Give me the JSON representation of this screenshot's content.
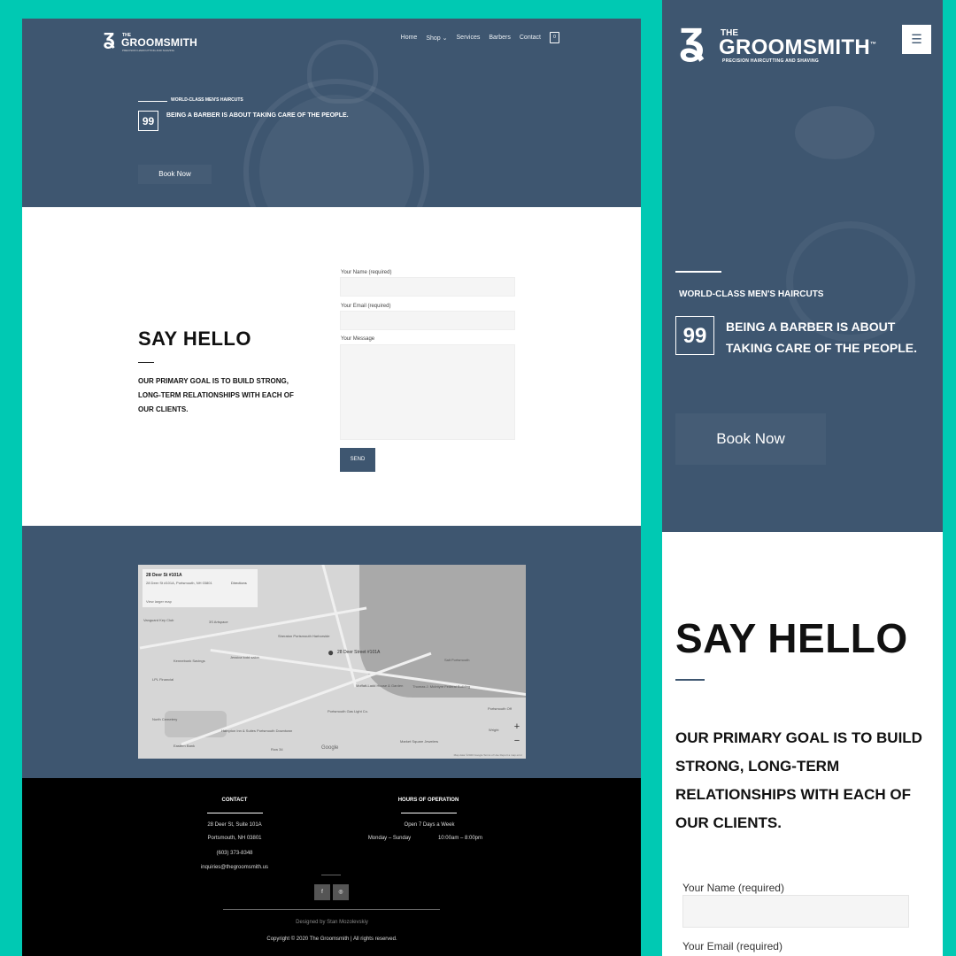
{
  "brand": {
    "the": "THE",
    "name": "GROOMSMITH",
    "tm": "™",
    "tagline": "PRECISION HAIRCUTTING AND SHAVING"
  },
  "nav": {
    "items": [
      "Home",
      "Shop",
      "Services",
      "Barbers",
      "Contact"
    ],
    "shop_caret": "⌄",
    "cart_count": "0"
  },
  "hero": {
    "eyebrow": "WORLD-CLASS MEN'S HAIRCUTS",
    "quote_mark": "99",
    "quote": "BEING A BARBER IS ABOUT TAKING CARE OF THE PEOPLE.",
    "cta": "Book Now"
  },
  "contact_section": {
    "title": "SAY HELLO",
    "text": "OUR  PRIMARY GOAL IS TO BUILD STRONG, LONG-TERM RELATIONSHIPS WITH EACH OF OUR CLIENTS."
  },
  "form": {
    "name_label": "Your Name (required)",
    "email_label": "Your Email (required)",
    "message_label": "Your Message",
    "send_label": "SEND"
  },
  "map": {
    "card_title": "28 Deer St #101A",
    "card_address": "28 Deer St #101A, Portsmouth, NH 03801",
    "directions": "Directions",
    "larger_map": "View larger map",
    "pin_label": "28 Deer Street #101A",
    "places": [
      "Vanguard Key Club",
      "3S Artspace",
      "Kennebunk Savings",
      "LPL Financial",
      "Jessica todd salon",
      "Sheraton Portsmouth Harborside",
      "Moffatt-Ladd House & Garden",
      "Portsmouth Gas Light Co.",
      "Thomas J. McIntyre Federal Building",
      "Hampton Inn & Suites Portsmouth Downtown",
      "North Cemetery",
      "Eastern Bank",
      "Market Square Jewelers",
      "Row 34",
      "Salt Portsmouth",
      "Portsmouth Off",
      "Wright"
    ],
    "zoom_in": "+",
    "zoom_out": "−",
    "google": "Google",
    "attribution": "Map data ©2020 Google   Terms of Use   Report a map error"
  },
  "footer": {
    "contact_heading": "CONTACT",
    "address1": "28 Deer St, Suite 101A",
    "address2": "Portsmouth, NH 03801",
    "phone": "(603) 373-8348",
    "email": "inquiries@thegroomsmith.us",
    "hours_heading": "HOURS OF OPERATION",
    "hours_line1": "Open 7 Days a Week",
    "hours_days": "Monday – Sunday",
    "hours_time": "10:00am – 8:00pm",
    "facebook": "f",
    "instagram": "◎",
    "designed_by": "Designed by Stan Mozolevskiy",
    "copyright": "Copyright © 2020 The Groomsmith | All rights reserved."
  },
  "mobile": {
    "menu_icon": "☰"
  },
  "colors": {
    "teal_bg": "#00c9b3",
    "slate": "#3e5670",
    "footer": "#000000"
  }
}
